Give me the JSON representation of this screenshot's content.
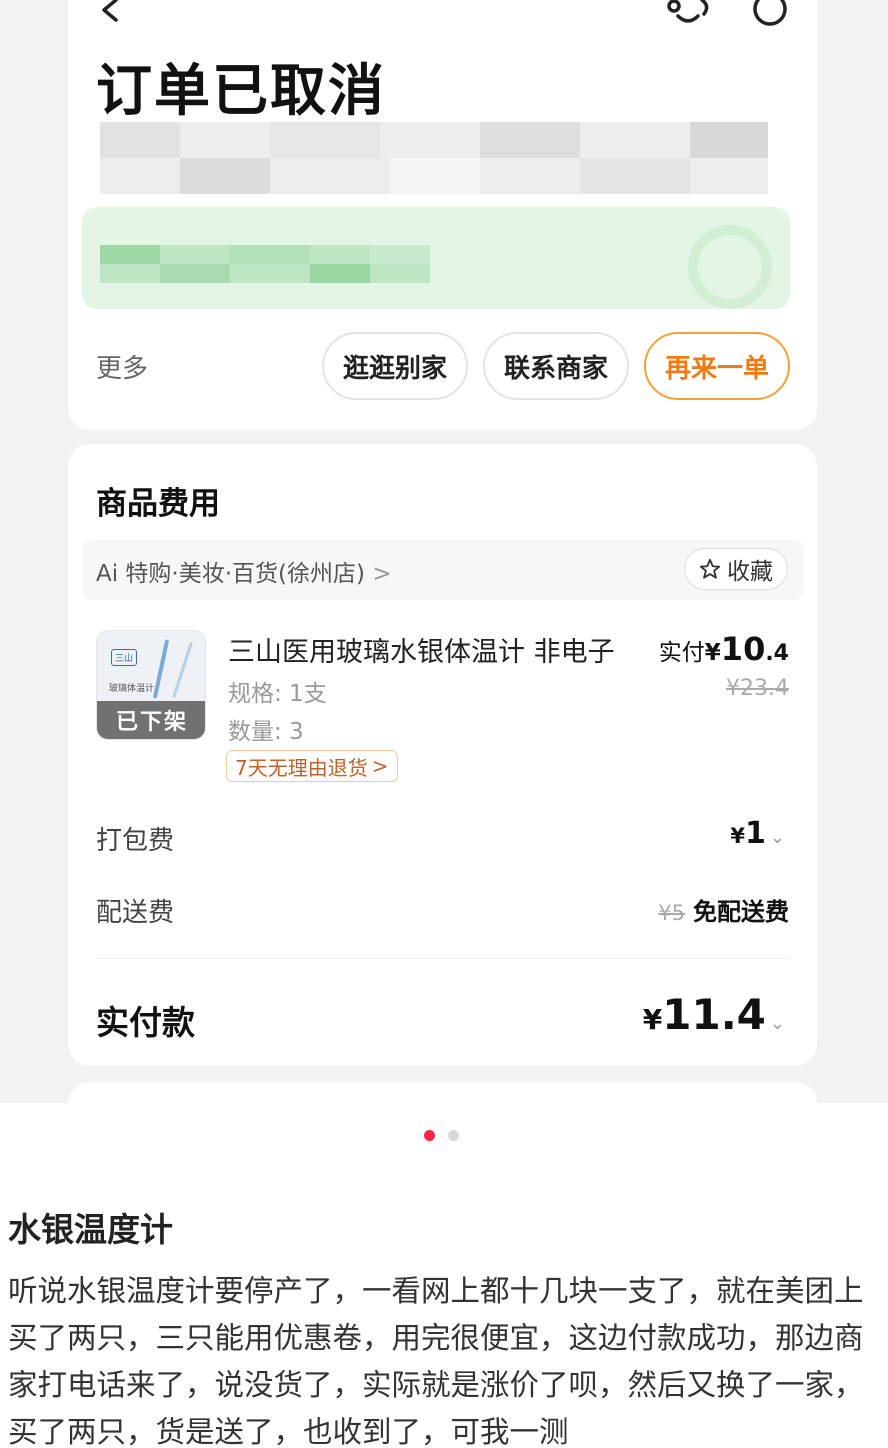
{
  "order": {
    "status_title": "订单已取消",
    "more_label": "更多",
    "actions": [
      "逛逛别家",
      "联系商家",
      "再来一单"
    ],
    "accent_color": "#f07a10"
  },
  "fees": {
    "section_title": "商品费用",
    "store_name": "Ai 特购·美妆·百货(徐州店)",
    "store_chevron": ">",
    "favorite_label": "收藏",
    "product": {
      "name": "三山医用玻璃水银体温计 非电子",
      "spec": "规格: 1支",
      "quantity": "数量: 3",
      "return_policy": "7天无理由退货",
      "return_chevron": ">",
      "status_badge": "已下架",
      "thumb_logo": "三山",
      "thumb_label": "玻璃体温计",
      "paid_label": "实付",
      "paid_currency": "¥",
      "paid_int": "10",
      "paid_dec": ".4",
      "original_price": "¥23.4"
    },
    "packing": {
      "label": "打包费",
      "currency": "¥",
      "value": "1"
    },
    "delivery": {
      "label": "配送费",
      "original": "¥5",
      "value": "免配送费"
    },
    "total": {
      "label": "实付款",
      "currency": "¥",
      "value": "11.4"
    },
    "chevron": "⌄"
  },
  "post": {
    "title": "水银温度计",
    "body": "听说水银温度计要停产了，一看网上都十几块一支了，就在美团上买了两只，三只能用优惠卷，用完很便宜，这边付款成功，那边商家打电话来了，说没货了，实际就是涨价了呗，然后又换了一家，买了两只，货是送了，也收到了，可我一测"
  },
  "carousel": {
    "active_color": "#ff2442",
    "inactive_color": "#d9d9d9"
  }
}
